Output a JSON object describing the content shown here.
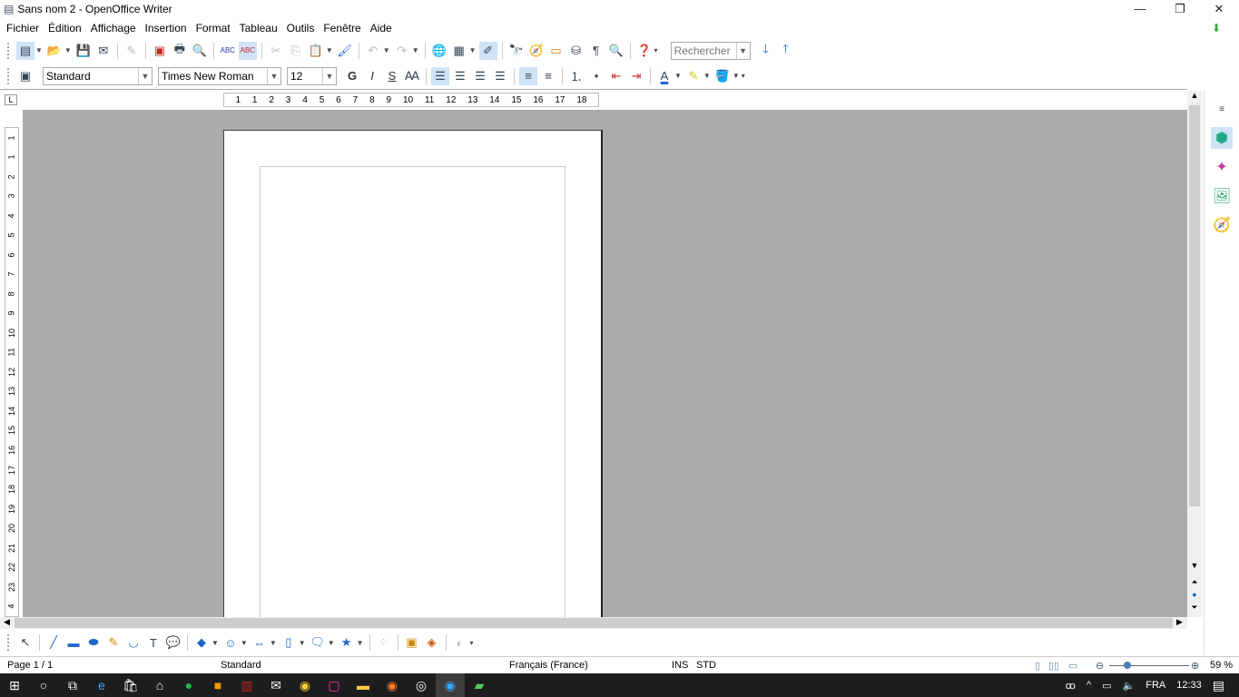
{
  "window": {
    "title": "Sans nom 2 - OpenOffice Writer",
    "minimize": "—",
    "maximize": "❐",
    "close": "✕"
  },
  "menu": [
    "Fichier",
    "Édition",
    "Affichage",
    "Insertion",
    "Format",
    "Tableau",
    "Outils",
    "Fenêtre",
    "Aide"
  ],
  "toolbar1": {
    "icons": [
      "new-document",
      "open",
      "save",
      "email",
      "edit-file",
      "export-pdf",
      "print",
      "print-preview",
      "spellcheck",
      "auto-spellcheck",
      "cut",
      "copy",
      "paste",
      "format-paintbrush",
      "undo",
      "redo",
      "hyperlink",
      "table",
      "show-draw-functions",
      "find-replace",
      "navigator",
      "gallery",
      "data-sources",
      "nonprinting-characters",
      "zoom",
      "help"
    ],
    "search_placeholder": "Rechercher"
  },
  "toolbar2": {
    "style": "Standard",
    "font": "Times New Roman",
    "size": "12",
    "bold": "G",
    "italic": "I",
    "shadow": "S"
  },
  "ruler": {
    "h": [
      "1",
      "1",
      "2",
      "3",
      "4",
      "5",
      "6",
      "7",
      "8",
      "9",
      "10",
      "11",
      "12",
      "13",
      "14",
      "15",
      "16",
      "17",
      "18"
    ],
    "v": [
      "1",
      "1",
      "2",
      "3",
      "4",
      "5",
      "6",
      "7",
      "8",
      "9",
      "10",
      "11",
      "12",
      "13",
      "14",
      "15",
      "16",
      "17",
      "18",
      "19",
      "20",
      "21",
      "22",
      "23",
      "4"
    ],
    "corner": "L"
  },
  "status": {
    "page": "Page 1 / 1",
    "style": "Standard",
    "language": "Français (France)",
    "insert": "INS",
    "select": "STD",
    "zoom": "59 %",
    "zoom_level": 59
  },
  "taskbar": {
    "lang": "FRA",
    "time": "12:33"
  },
  "colors": {
    "accent": "#cfe3f7",
    "doc_bg": "#ababab",
    "taskbar": "#1d1d1d"
  }
}
